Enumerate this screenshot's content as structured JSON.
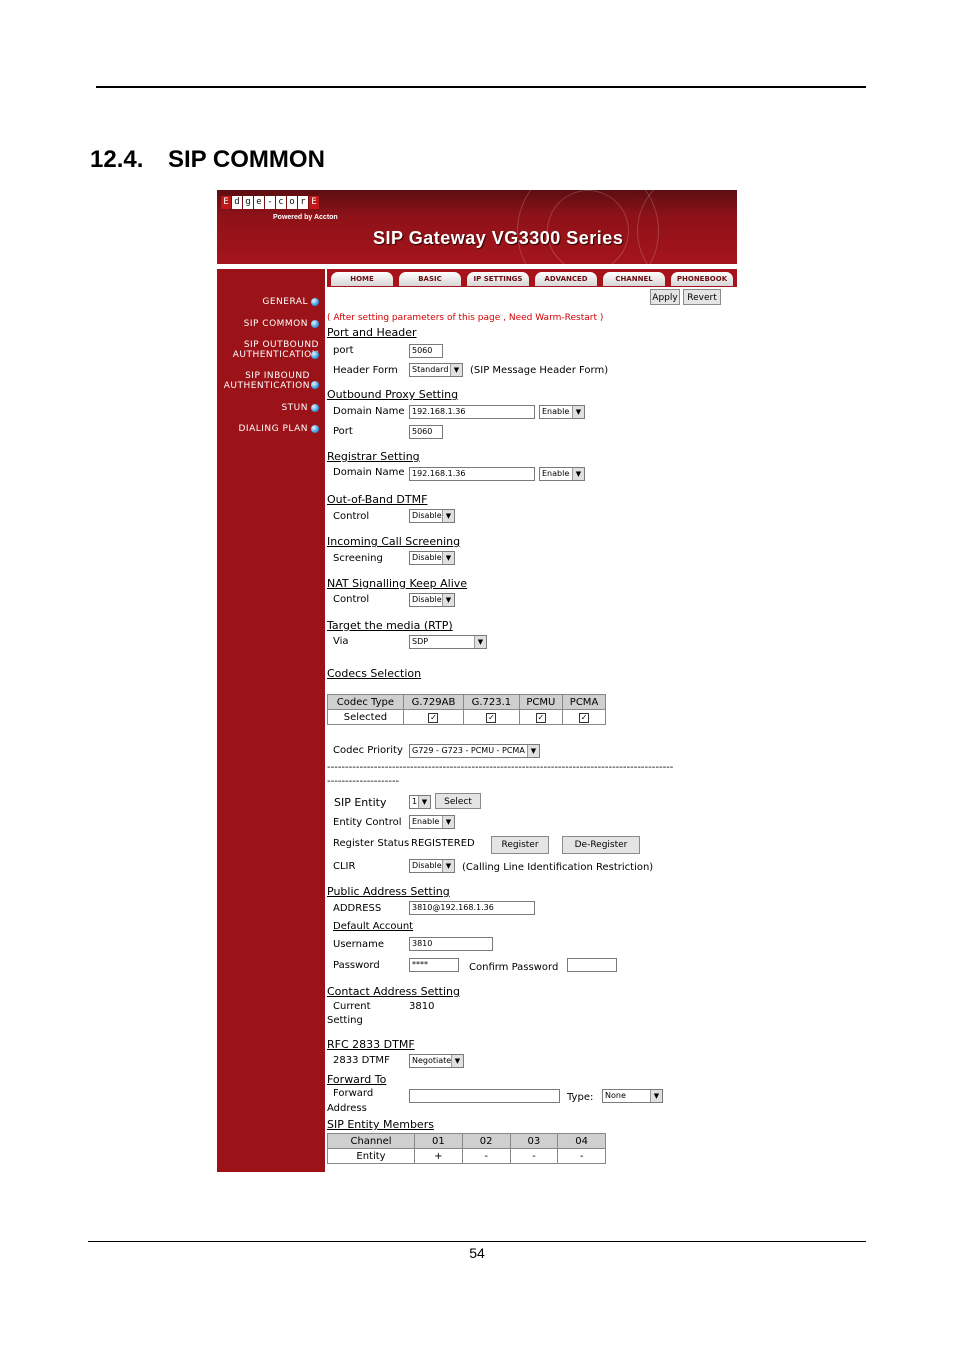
{
  "doc": {
    "section_number": "12.4.",
    "section_title": "SIP COMMON",
    "page_number": "54"
  },
  "banner": {
    "logo_letters": [
      "E",
      "d",
      "g",
      "e",
      "-",
      "c",
      "o",
      "r",
      "E"
    ],
    "powered_by": "Powered by Accton",
    "title": "SIP Gateway VG3300 Series"
  },
  "sidebar": {
    "items": [
      {
        "label": "GENERAL"
      },
      {
        "label": "SIP COMMON"
      },
      {
        "label": "SIP OUTBOUND\nAUTHENTICATION"
      },
      {
        "label": "SIP INBOUND\nAUTHENTICATION"
      },
      {
        "label": "STUN"
      },
      {
        "label": "DIALING PLAN"
      }
    ]
  },
  "tabs": [
    "HOME",
    "BASIC",
    "IP SETTINGS",
    "ADVANCED",
    "CHANNEL",
    "PHONEBOOK"
  ],
  "actions": {
    "apply": "Apply",
    "revert": "Revert"
  },
  "warning": "( After setting parameters of this page , Need Warm-Restart )",
  "port_header": {
    "heading": "Port and Header",
    "port_label": "port",
    "port_value": "5060",
    "header_form_label": "Header Form",
    "header_form_value": "Standard",
    "header_form_note": "(SIP Message Header Form)"
  },
  "outbound_proxy": {
    "heading": "Outbound Proxy Setting",
    "domain_label": "Domain Name",
    "domain_value": "192.168.1.36",
    "enable_value": "Enable",
    "port_label": "Port",
    "port_value": "5060"
  },
  "registrar": {
    "heading": "Registrar Setting",
    "domain_label": "Domain Name",
    "domain_value": "192.168.1.36",
    "enable_value": "Enable"
  },
  "dtmf_oob": {
    "heading": "Out-of-Band DTMF",
    "label": "Control",
    "value": "Disable"
  },
  "call_screening": {
    "heading": "Incoming Call Screening",
    "label": "Screening",
    "value": "Disable"
  },
  "nat_keepalive": {
    "heading": "NAT Signalling Keep Alive",
    "label": "Control",
    "value": "Disable"
  },
  "media_target": {
    "heading": "Target the media (RTP)",
    "label": "Via",
    "value": "SDP"
  },
  "codecs": {
    "heading": "Codecs Selection",
    "header": [
      "Codec Type",
      "G.729AB",
      "G.723.1",
      "PCMU",
      "PCMA"
    ],
    "row_label": "Selected",
    "checks": [
      "✓",
      "✓",
      "✓",
      "✓"
    ],
    "priority_label": "Codec Priority",
    "priority_value": "G729 - G723 - PCMU - PCMA"
  },
  "dashes_long": "------------------------------------------------------------------------------------------------",
  "dashes_short": "--------------------",
  "entity": {
    "entity_label": "SIP Entity",
    "entity_value": "1",
    "select_button": "Select",
    "control_label": "Entity Control",
    "control_value": "Enable",
    "register_status_label": "Register Status",
    "register_status_value": "REGISTERED",
    "register_button": "Register",
    "deregister_button": "De-Register",
    "clir_label": "CLIR",
    "clir_value": "Disable",
    "clir_note": "(Calling Line Identification Restriction)"
  },
  "public_address": {
    "heading": "Public Address Setting",
    "address_label": "ADDRESS",
    "address_value": "3810@192.168.1.36",
    "default_account": "Default Account",
    "username_label": "Username",
    "username_value": "3810",
    "password_label": "Password",
    "password_value": "****",
    "confirm_label": "Confirm Password",
    "confirm_value": ""
  },
  "contact_address": {
    "heading": "Contact Address Setting",
    "current_label": "Current",
    "current_value": "3810",
    "setting_label": "Setting"
  },
  "rfc2833": {
    "heading": "RFC 2833 DTMF",
    "label": "2833 DTMF",
    "value": "Negotiate"
  },
  "forward": {
    "heading": "Forward To",
    "label_line1": "Forward",
    "label_line2": "Address",
    "value": "",
    "type_label": "Type:",
    "type_value": "None"
  },
  "members": {
    "heading": "SIP Entity Members",
    "header": [
      "Channel",
      "01",
      "02",
      "03",
      "04"
    ],
    "row": [
      "Entity",
      "+",
      "-",
      "-",
      "-"
    ]
  }
}
